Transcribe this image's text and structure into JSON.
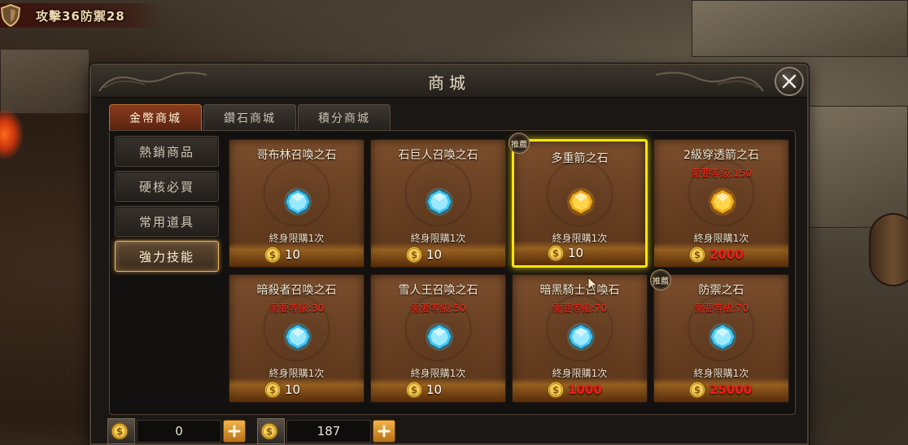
{
  "status": {
    "text": "攻擊36防禦28"
  },
  "dialog": {
    "title": "商城"
  },
  "tabs": [
    {
      "label": "金幣商城",
      "active": true
    },
    {
      "label": "鑽石商城",
      "active": false
    },
    {
      "label": "積分商城",
      "active": false
    }
  ],
  "sidebar": {
    "items": [
      {
        "label": "熱銷商品",
        "active": false
      },
      {
        "label": "硬核必買",
        "active": false
      },
      {
        "label": "常用道具",
        "active": false
      },
      {
        "label": "強力技能",
        "active": true
      }
    ]
  },
  "items": [
    {
      "name": "哥布林召喚之石",
      "requirement": "",
      "limit": "終身限購1次",
      "price": "10",
      "gem": "blue-gem-icon",
      "price_red": false,
      "selected": false,
      "recommended": false
    },
    {
      "name": "石巨人召喚之石",
      "requirement": "",
      "limit": "終身限購1次",
      "price": "10",
      "gem": "blue-gem-icon",
      "price_red": false,
      "selected": false,
      "recommended": false
    },
    {
      "name": "多重箭之石",
      "requirement": "",
      "limit": "終身限購1次",
      "price": "10",
      "gem": "gold-gem-icon",
      "price_red": false,
      "selected": true,
      "recommended": true
    },
    {
      "name": "2級穿透箭之石",
      "requirement": "需要等級:150",
      "limit": "終身限購1次",
      "price": "2000",
      "gem": "gold-gem-icon",
      "price_red": true,
      "selected": false,
      "recommended": false
    },
    {
      "name": "暗殺者召喚之石",
      "requirement": "需要等級:30",
      "limit": "終身限購1次",
      "price": "10",
      "gem": "blue-gem-icon",
      "price_red": false,
      "selected": false,
      "recommended": false
    },
    {
      "name": "雪人王召喚之石",
      "requirement": "需要等級:50",
      "limit": "終身限購1次",
      "price": "10",
      "gem": "blue-gem-icon",
      "price_red": false,
      "selected": false,
      "recommended": false
    },
    {
      "name": "暗黑騎士召喚石",
      "requirement": "需要等級:70",
      "limit": "終身限購1次",
      "price": "1000",
      "gem": "blue-gem-icon",
      "price_red": true,
      "selected": false,
      "recommended": false
    },
    {
      "name": "防禦之石",
      "requirement": "需要等級:70",
      "limit": "終身限購1次",
      "price": "25000",
      "gem": "blue-gem-icon",
      "price_red": true,
      "selected": false,
      "recommended": true
    }
  ],
  "badge_label": "推薦",
  "currencies": [
    {
      "amount": "0"
    },
    {
      "amount": "187"
    }
  ],
  "colors": {
    "selected_border": "#ffe400",
    "requirement_red": "#ff2a1a",
    "active_tab": "#8a3a1c"
  }
}
